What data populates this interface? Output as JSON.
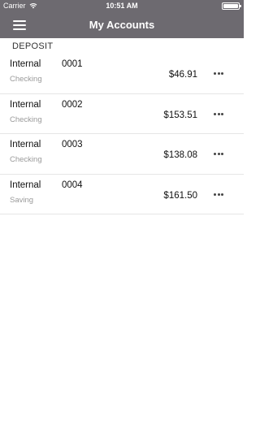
{
  "status_bar": {
    "carrier": "Carrier",
    "time": "10:51 AM",
    "wifi_icon": "wifi-icon",
    "battery_icon": "battery-icon"
  },
  "header": {
    "title": "My Accounts",
    "menu_icon": "hamburger-menu-icon",
    "background_color": "#6d6a70"
  },
  "section": {
    "title": "DEPOSIT"
  },
  "accounts": [
    {
      "name": "Internal",
      "number": "0001",
      "type": "Checking",
      "balance": "$46.91"
    },
    {
      "name": "Internal",
      "number": "0002",
      "type": "Checking",
      "balance": "$153.51"
    },
    {
      "name": "Internal",
      "number": "0003",
      "type": "Checking",
      "balance": "$138.08"
    },
    {
      "name": "Internal",
      "number": "0004",
      "type": "Saving",
      "balance": "$161.50"
    }
  ],
  "row_action_icon": "more-horizontal-icon"
}
